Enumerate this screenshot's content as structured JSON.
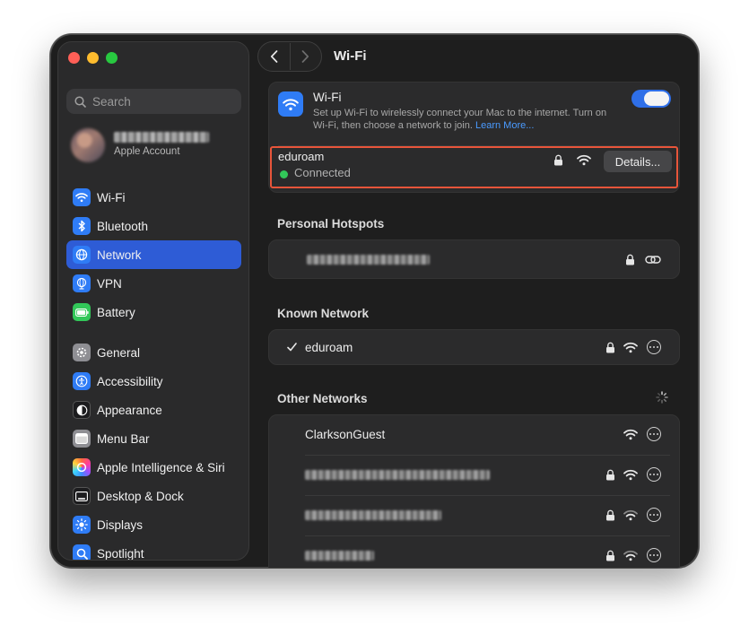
{
  "window": {
    "title": "Wi-Fi"
  },
  "search": {
    "placeholder": "Search"
  },
  "account": {
    "subtitle": "Apple Account"
  },
  "sidebar": {
    "items": [
      {
        "label": "Wi-Fi",
        "icon": "wifi-icon",
        "color": "#2f7cf6"
      },
      {
        "label": "Bluetooth",
        "icon": "bluetooth-icon",
        "color": "#2f7cf6"
      },
      {
        "label": "Network",
        "icon": "globe-icon",
        "color": "#2f7cf6",
        "active": true
      },
      {
        "label": "VPN",
        "icon": "vpn-globe-icon",
        "color": "#2f7cf6"
      },
      {
        "label": "Battery",
        "icon": "battery-icon",
        "color": "#32c759"
      },
      {
        "label": "General",
        "icon": "gear-icon",
        "color": "#8e8e93"
      },
      {
        "label": "Accessibility",
        "icon": "accessibility-icon",
        "color": "#2f7cf6"
      },
      {
        "label": "Appearance",
        "icon": "appearance-icon",
        "color": "#1c1c1e"
      },
      {
        "label": "Menu Bar",
        "icon": "menu-bar-icon",
        "color": "#8e8e93"
      },
      {
        "label": "Apple Intelligence & Siri",
        "icon": "siri-icon",
        "color": "#c44fd8"
      },
      {
        "label": "Desktop & Dock",
        "icon": "desktop-dock-icon",
        "color": "#1c1c1e"
      },
      {
        "label": "Displays",
        "icon": "displays-icon",
        "color": "#2f7cf6"
      },
      {
        "label": "Spotlight",
        "icon": "spotlight-icon",
        "color": "#2f7cf6"
      }
    ]
  },
  "wifi": {
    "title": "Wi-Fi",
    "description": "Set up Wi-Fi to wirelessly connect your Mac to the internet. Turn on Wi-Fi, then choose a network to join.",
    "learn_more": "Learn More...",
    "enabled": true,
    "current": {
      "name": "eduroam",
      "status": "Connected",
      "details_label": "Details..."
    }
  },
  "personal_hotspots": {
    "title": "Personal Hotspots"
  },
  "known_network": {
    "title": "Known Network",
    "name": "eduroam"
  },
  "other_networks": {
    "title": "Other Networks",
    "first": "ClarksonGuest"
  },
  "colors": {
    "accent": "#2e5cd6",
    "highlight_border": "#e8553a",
    "connected_dot": "#32c759",
    "toggle": "#2f6fe8"
  }
}
